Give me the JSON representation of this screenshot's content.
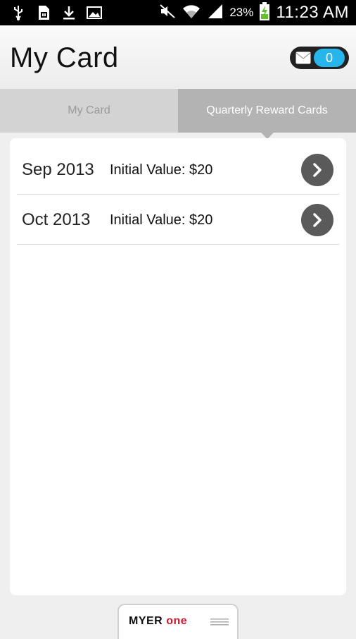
{
  "status_bar": {
    "battery_percent": "23%",
    "clock": "11:23 AM",
    "icons": [
      "usb-icon",
      "sim-icon",
      "download-icon",
      "image-icon",
      "mute-icon",
      "wifi-icon",
      "signal-icon",
      "battery-charging-icon"
    ]
  },
  "header": {
    "title": "My Card",
    "message_count": "0",
    "message_icon": "envelope-icon"
  },
  "tabs": [
    {
      "label": "My Card",
      "active": false
    },
    {
      "label": "Quarterly Reward Cards",
      "active": true
    }
  ],
  "reward_cards": [
    {
      "date": "Sep 2013",
      "value": "Initial Value: $20"
    },
    {
      "date": "Oct 2013",
      "value": "Initial Value: $20"
    }
  ],
  "footer": {
    "logo_part1": "MYER",
    "logo_part2": "one"
  },
  "colors": {
    "accent_blue": "#27b6ec",
    "brand_red": "#d3162b",
    "tab_active": "#b3b3b3",
    "tab_inactive": "#d3d3d3"
  }
}
